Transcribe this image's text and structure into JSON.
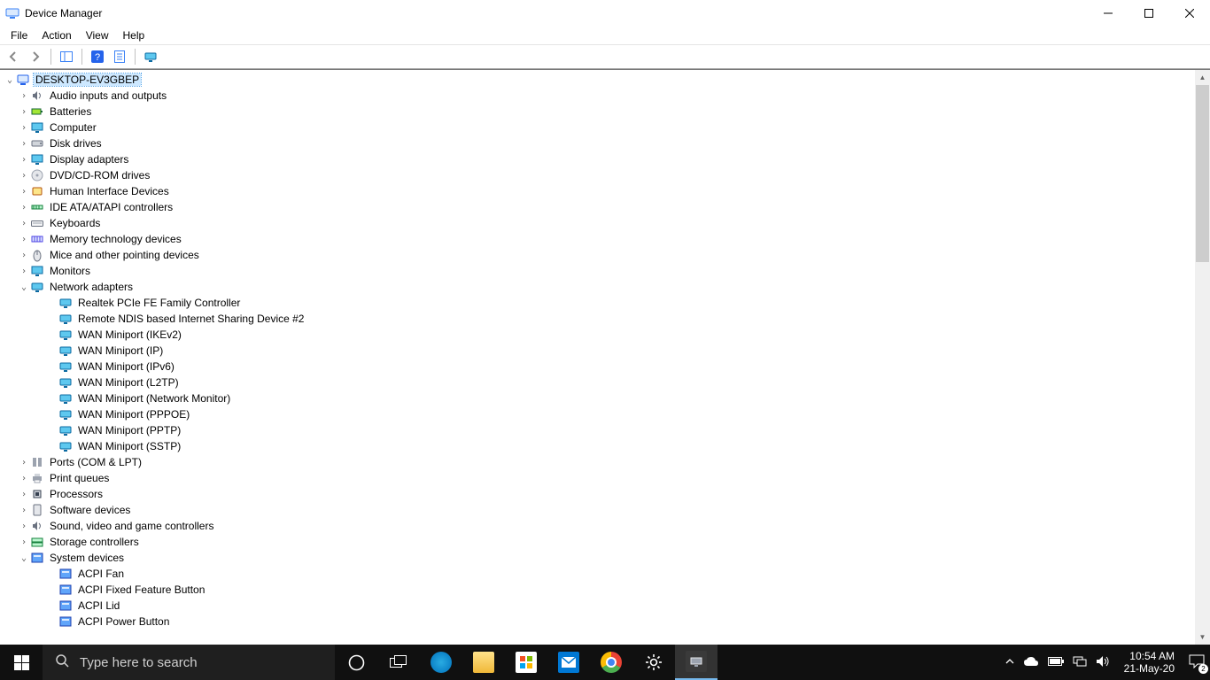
{
  "window": {
    "title": "Device Manager"
  },
  "menu": {
    "file": "File",
    "action": "Action",
    "view": "View",
    "help": "Help"
  },
  "search": {
    "placeholder": "Type here to search"
  },
  "tray": {
    "time": "10:54 AM",
    "date": "21-May-20",
    "action_center_badge": "2"
  },
  "tree": {
    "root": {
      "label": "DESKTOP-EV3GBEP",
      "expanded": true
    },
    "categories": [
      {
        "label": "Audio inputs and outputs",
        "icon": "speaker",
        "expanded": false
      },
      {
        "label": "Batteries",
        "icon": "battery",
        "expanded": false
      },
      {
        "label": "Computer",
        "icon": "monitor",
        "expanded": false
      },
      {
        "label": "Disk drives",
        "icon": "disk",
        "expanded": false
      },
      {
        "label": "Display adapters",
        "icon": "monitor",
        "expanded": false
      },
      {
        "label": "DVD/CD-ROM drives",
        "icon": "optical",
        "expanded": false
      },
      {
        "label": "Human Interface Devices",
        "icon": "hid",
        "expanded": false
      },
      {
        "label": "IDE ATA/ATAPI controllers",
        "icon": "ide",
        "expanded": false
      },
      {
        "label": "Keyboards",
        "icon": "keyboard",
        "expanded": false
      },
      {
        "label": "Memory technology devices",
        "icon": "memory",
        "expanded": false
      },
      {
        "label": "Mice and other pointing devices",
        "icon": "mouse",
        "expanded": false
      },
      {
        "label": "Monitors",
        "icon": "monitor",
        "expanded": false
      },
      {
        "label": "Network adapters",
        "icon": "network",
        "expanded": true,
        "children": [
          "Realtek PCIe FE Family Controller",
          "Remote NDIS based Internet Sharing Device #2",
          "WAN Miniport (IKEv2)",
          "WAN Miniport (IP)",
          "WAN Miniport (IPv6)",
          "WAN Miniport (L2TP)",
          "WAN Miniport (Network Monitor)",
          "WAN Miniport (PPPOE)",
          "WAN Miniport (PPTP)",
          "WAN Miniport (SSTP)"
        ]
      },
      {
        "label": "Ports (COM & LPT)",
        "icon": "port",
        "expanded": false
      },
      {
        "label": "Print queues",
        "icon": "printer",
        "expanded": false
      },
      {
        "label": "Processors",
        "icon": "cpu",
        "expanded": false
      },
      {
        "label": "Software devices",
        "icon": "software",
        "expanded": false
      },
      {
        "label": "Sound, video and game controllers",
        "icon": "speaker",
        "expanded": false
      },
      {
        "label": "Storage controllers",
        "icon": "storage",
        "expanded": false
      },
      {
        "label": "System devices",
        "icon": "system",
        "expanded": true,
        "children": [
          "ACPI Fan",
          "ACPI Fixed Feature Button",
          "ACPI Lid",
          "ACPI Power Button"
        ]
      }
    ]
  }
}
